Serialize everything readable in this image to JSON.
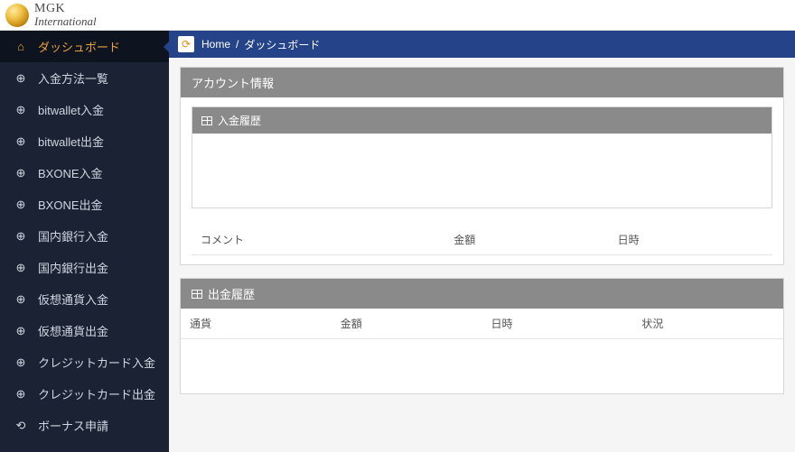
{
  "brand": {
    "l1": "MGK",
    "l2": "International"
  },
  "breadcrumb": {
    "home": "Home",
    "sep": "/",
    "current": "ダッシュボード"
  },
  "sidebar": {
    "items": [
      {
        "label": "ダッシュボード",
        "icon": "home",
        "active": true
      },
      {
        "label": "入金方法一覧",
        "icon": "circle-arrow"
      },
      {
        "label": "bitwallet入金",
        "icon": "circle-arrow"
      },
      {
        "label": "bitwallet出金",
        "icon": "circle-arrow"
      },
      {
        "label": "BXONE入金",
        "icon": "circle-arrow"
      },
      {
        "label": "BXONE出金",
        "icon": "circle-arrow"
      },
      {
        "label": "国内銀行入金",
        "icon": "circle-arrow"
      },
      {
        "label": "国内銀行出金",
        "icon": "circle-arrow"
      },
      {
        "label": "仮想通貨入金",
        "icon": "circle-arrow"
      },
      {
        "label": "仮想通貨出金",
        "icon": "circle-arrow"
      },
      {
        "label": "クレジットカード入金",
        "icon": "circle-arrow"
      },
      {
        "label": "クレジットカード出金",
        "icon": "circle-arrow"
      },
      {
        "label": "ボーナス申請",
        "icon": "share"
      }
    ]
  },
  "account_panel": {
    "title": "アカウント情報",
    "deposit_history": {
      "title": "入金履歴",
      "columns": [
        "コメント",
        "金額",
        "日時"
      ]
    }
  },
  "withdraw_panel": {
    "title": "出金履歴",
    "columns": [
      "通貨",
      "金額",
      "日時",
      "状況"
    ]
  },
  "icons": {
    "home": "⌂",
    "circle-arrow": "⊕",
    "share": "⟲",
    "refresh": "⟳"
  }
}
